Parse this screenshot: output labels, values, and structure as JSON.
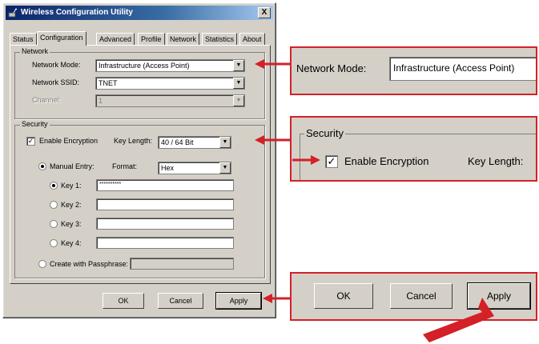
{
  "window": {
    "title": "Wireless Configuration Utility",
    "close_label": "X"
  },
  "tabs": [
    "Status",
    "Configuration",
    "Advanced",
    "Profile",
    "Network",
    "Statistics",
    "About"
  ],
  "network_group": {
    "label": "Network",
    "mode_label": "Network Mode:",
    "mode_value": "Infrastructure (Access Point)",
    "ssid_label": "Network SSID:",
    "ssid_value": "TNET",
    "channel_label": "Channel:",
    "channel_value": "1"
  },
  "security_group": {
    "label": "Security",
    "enable_label": "Enable Encryption",
    "enable_mark": "✓",
    "key_length_label": "Key Length:",
    "key_length_value": "40 / 64 Bit",
    "manual_entry_label": "Manual Entry:",
    "format_label": "Format:",
    "format_value": "Hex",
    "keys": [
      {
        "label": "Key 1:",
        "value": "**********"
      },
      {
        "label": "Key 2:",
        "value": ""
      },
      {
        "label": "Key 3:",
        "value": ""
      },
      {
        "label": "Key 4:",
        "value": ""
      }
    ],
    "passphrase_label": "Create with Passphrase:"
  },
  "buttons": {
    "ok": "OK",
    "cancel": "Cancel",
    "apply": "Apply"
  },
  "zoom": {
    "mode_label": "Network Mode:",
    "mode_value": "Infrastructure (Access Point)",
    "security_label": "Security",
    "enable_label": "Enable Encryption",
    "enable_mark": "✓",
    "key_length_label": "Key Length:",
    "ok": "OK",
    "cancel": "Cancel",
    "apply": "Apply"
  },
  "colors": {
    "callout": "#d42027",
    "dialog": "#d4d0c8",
    "titlebar": "#0a246a"
  }
}
